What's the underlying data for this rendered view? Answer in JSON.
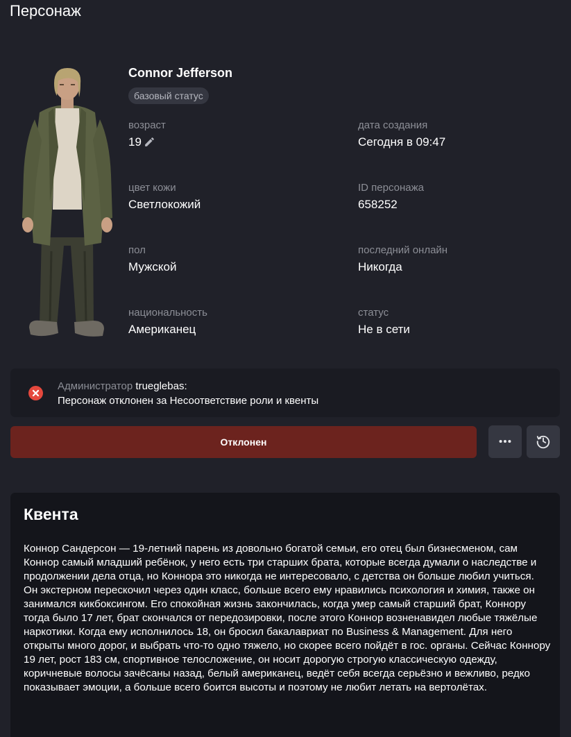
{
  "page": {
    "title": "Персонаж"
  },
  "character": {
    "name": "Connor Jefferson",
    "badge": "базовый статус",
    "fields": {
      "age": {
        "label": "возраст",
        "value": "19"
      },
      "created": {
        "label": "дата создания",
        "value": "Сегодня в 09:47"
      },
      "skin": {
        "label": "цвет кожи",
        "value": "Светлокожий"
      },
      "id": {
        "label": "ID персонажа",
        "value": "658252"
      },
      "sex": {
        "label": "пол",
        "value": "Мужской"
      },
      "last_online": {
        "label": "последний онлайн",
        "value": "Никогда"
      },
      "nationality": {
        "label": "национальность",
        "value": "Американец"
      },
      "status": {
        "label": "статус",
        "value": "Не в сети"
      }
    }
  },
  "notice": {
    "role": "Администратор",
    "user": "trueglebas:",
    "message": "Персонаж отклонен за Несоответствие роли и квенты",
    "icon": "error-x-icon"
  },
  "actions": {
    "status_label": "Отклонен",
    "more_icon": "more-dots-icon",
    "history_icon": "history-clock-icon"
  },
  "story": {
    "title": "Квента",
    "text": "Коннор Сандерсон — 19-летний парень из довольно богатой семьи, его отец был бизнесменом, сам Коннор самый младший ребёнок, у него есть три старших брата, которые всегда думали о наследстве и продолжении дела отца, но Коннора это никогда не интересовало, с детства он больше любил учиться. Он экстерном перескочил через один класс, больше всего ему нравились психология и химия, также он занимался кикбоксингом. Его спокойная жизнь закончилась, когда умер самый старший брат, Коннору тогда было 17 лет, брат скончался от передозировки, после этого Коннор возненавидел любые тяжёлые наркотики. Когда ему исполнилось 18, он бросил бакалавриат по Business & Management. Для него открыты много дорог, и выбрать что-то одно тяжело, но скорее всего пойдёт в гос. органы. Сейчас Коннору 19 лет, рост 183 см, спортивное телосложение, он носит дорогую строгую классическую одежду, коричневые волосы зачёсаны назад, белый американец, ведёт себя всегда серьёзно и вежливо, редко показывает эмоции, а больше всего боится высоты и поэтому не любит летать на вертолётах."
  },
  "colors": {
    "background": "#202129",
    "card": "#1a1b22",
    "story_card": "#14151b",
    "rejected": "#6c231e",
    "error": "#e5483d",
    "muted_text": "#8c8e96"
  }
}
